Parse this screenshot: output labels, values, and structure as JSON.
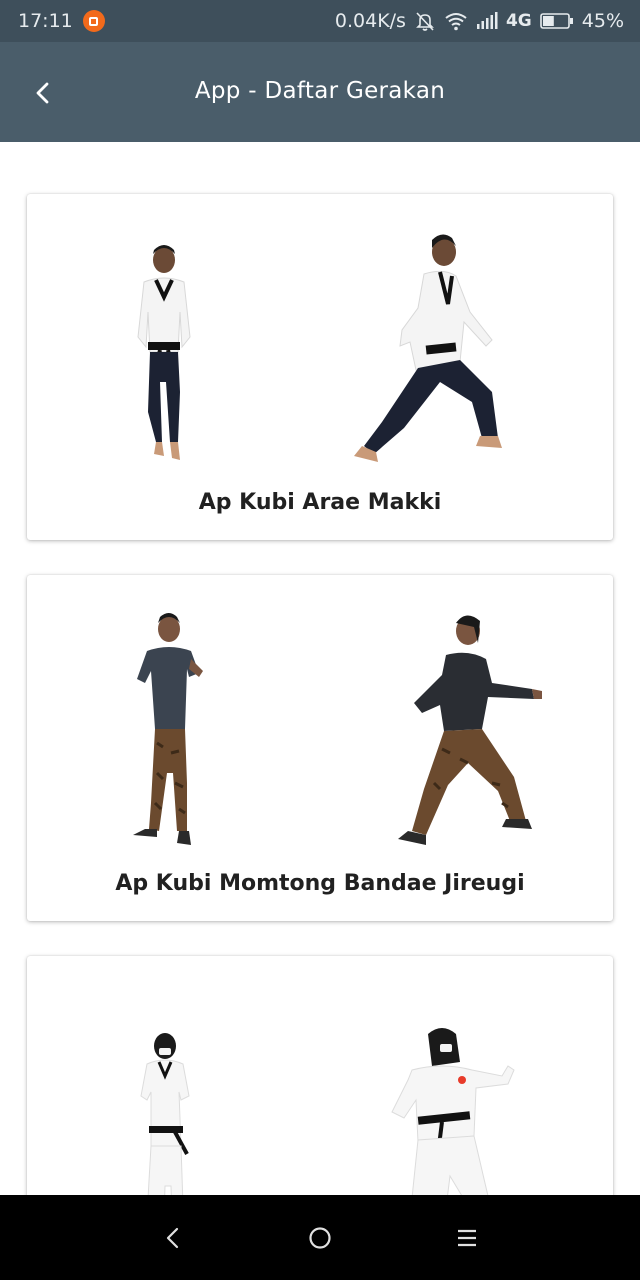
{
  "status_bar": {
    "time": "17:11",
    "network_speed": "0.04K/s",
    "network_type": "4G",
    "battery": "45%",
    "battery_level": 0.45,
    "icons": [
      "notification-app-icon",
      "silent-bell-icon",
      "wifi-icon",
      "signal-icon",
      "battery-icon"
    ]
  },
  "app_bar": {
    "title": "App - Daftar Gerakan",
    "back_icon": "chevron-left-icon",
    "color": "#4a5d6a"
  },
  "moves": [
    {
      "name": "Ap Kubi Arae Makki",
      "images": [
        "taekwondo-front-view-figure",
        "taekwondo-side-view-figure"
      ],
      "outfit": "white dobok, black belt"
    },
    {
      "name": "Ap Kubi Momtong Bandae Jireugi",
      "images": [
        "front-view-figure",
        "side-view-figure"
      ],
      "outfit": "dark t-shirt, batik pants"
    },
    {
      "name": "",
      "images": [
        "front-view-figure",
        "side-view-figure"
      ],
      "outfit": "white dobok, black belt, hijab"
    }
  ],
  "nav_bar": {
    "buttons": [
      "back-triangle-icon",
      "home-circle-icon",
      "menu-lines-icon"
    ]
  }
}
